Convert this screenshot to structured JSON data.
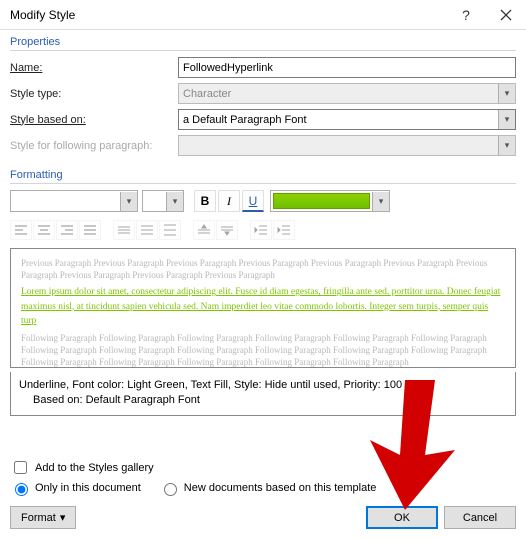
{
  "titlebar": {
    "title": "Modify Style"
  },
  "properties": {
    "section_label": "Properties",
    "name_label": "Name:",
    "name_value": "FollowedHyperlink",
    "type_label": "Style type:",
    "type_value": "Character",
    "based_label": "Style based on:",
    "based_value": "a Default Paragraph Font",
    "following_label": "Style for following paragraph:",
    "following_value": ""
  },
  "formatting": {
    "section_label": "Formatting"
  },
  "preview": {
    "prev_para": "Previous Paragraph Previous Paragraph Previous Paragraph Previous Paragraph Previous Paragraph Previous Paragraph Previous Paragraph Previous Paragraph Previous Paragraph Previous Paragraph",
    "sample": "Lorem ipsum dolor sit amet, consectetur adipiscing elit. Fusce id diam egestas, fringilla ante sed, porttitor urna. Donec feugiat maximus nisl, at tincidunt sapien vehicula sed. Nam imperdiet leo vitae commodo lobortis. Integer sem turpis, semper quis turp",
    "next_para": "Following Paragraph Following Paragraph Following Paragraph Following Paragraph Following Paragraph Following Paragraph Following Paragraph Following Paragraph Following Paragraph Following Paragraph Following Paragraph Following Paragraph Following Paragraph Following Paragraph Following Paragraph Following Paragraph Following Paragraph"
  },
  "description": {
    "line1": "Underline, Font color: Light Green, Text Fill, Style: Hide until used, Priority: 100",
    "line2": "Based on: Default Paragraph Font"
  },
  "options": {
    "add_gallery": "Add to the Styles gallery",
    "only_doc": "Only in this document",
    "new_tmpl": "New documents based on this template"
  },
  "buttons": {
    "format": "Format",
    "ok": "OK",
    "cancel": "Cancel"
  }
}
